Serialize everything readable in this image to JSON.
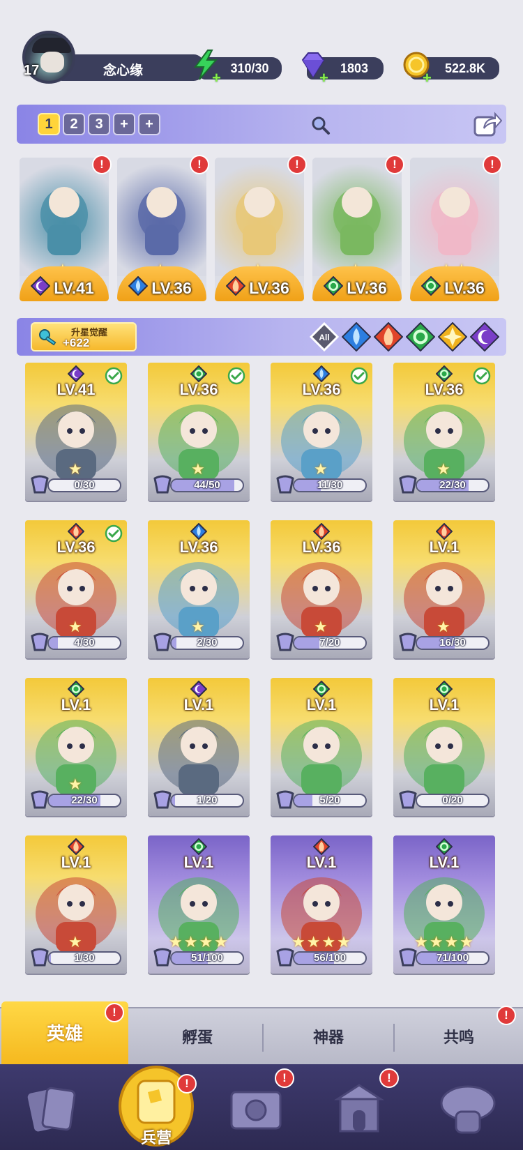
{
  "player": {
    "level": "17",
    "name": "念心缘"
  },
  "resources": {
    "energy": "310/30",
    "gems": "1803",
    "gold": "522.8K"
  },
  "team_tabs": [
    "1",
    "2",
    "3",
    "+",
    "+"
  ],
  "team": [
    {
      "element": "dark",
      "level": "LV.41",
      "stars": 1,
      "alert": "!"
    },
    {
      "element": "water",
      "level": "LV.36",
      "stars": 1,
      "alert": "!"
    },
    {
      "element": "fire",
      "level": "LV.36",
      "stars": 1,
      "alert": "!"
    },
    {
      "element": "wind",
      "level": "LV.36",
      "stars": 1,
      "alert": "!"
    },
    {
      "element": "wind",
      "level": "LV.36",
      "stars": 2,
      "alert": "!"
    }
  ],
  "awaken": {
    "label": "升星觉醒",
    "value": "+622"
  },
  "filters": [
    "All",
    "water",
    "fire",
    "wind",
    "light",
    "dark"
  ],
  "heroes": [
    {
      "element": "dark",
      "level": "LV.41",
      "progress": "0/30",
      "frac": 0.0,
      "checked": true,
      "frame": "gold",
      "stars": 1
    },
    {
      "element": "wind",
      "level": "LV.36",
      "progress": "44/50",
      "frac": 0.88,
      "checked": true,
      "frame": "gold",
      "stars": 1
    },
    {
      "element": "water",
      "level": "LV.36",
      "progress": "11/30",
      "frac": 0.37,
      "checked": true,
      "frame": "gold",
      "stars": 1
    },
    {
      "element": "wind",
      "level": "LV.36",
      "progress": "22/30",
      "frac": 0.73,
      "checked": true,
      "frame": "gold",
      "stars": 1
    },
    {
      "element": "fire",
      "level": "LV.36",
      "progress": "4/30",
      "frac": 0.13,
      "checked": true,
      "frame": "gold",
      "stars": 1
    },
    {
      "element": "water",
      "level": "LV.36",
      "progress": "2/30",
      "frac": 0.07,
      "checked": false,
      "frame": "gold",
      "stars": 1
    },
    {
      "element": "fire",
      "level": "LV.36",
      "progress": "7/20",
      "frac": 0.35,
      "checked": false,
      "frame": "gold",
      "stars": 1
    },
    {
      "element": "fire",
      "level": "LV.1",
      "progress": "16/30",
      "frac": 0.53,
      "checked": false,
      "frame": "gold",
      "stars": 1
    },
    {
      "element": "wind",
      "level": "LV.1",
      "progress": "22/30",
      "frac": 0.73,
      "checked": false,
      "frame": "gold",
      "stars": 1
    },
    {
      "element": "dark",
      "level": "LV.1",
      "progress": "1/20",
      "frac": 0.05,
      "checked": false,
      "frame": "gold",
      "stars": 0
    },
    {
      "element": "wind",
      "level": "LV.1",
      "progress": "5/20",
      "frac": 0.25,
      "checked": false,
      "frame": "gold",
      "stars": 0
    },
    {
      "element": "wind",
      "level": "LV.1",
      "progress": "0/20",
      "frac": 0.0,
      "checked": false,
      "frame": "gold",
      "stars": 0
    },
    {
      "element": "fire",
      "level": "LV.1",
      "progress": "1/30",
      "frac": 0.03,
      "checked": false,
      "frame": "gold",
      "stars": 1
    },
    {
      "element": "wind",
      "level": "LV.1",
      "progress": "51/100",
      "frac": 0.51,
      "checked": false,
      "frame": "purple",
      "stars": 4
    },
    {
      "element": "fire",
      "level": "LV.1",
      "progress": "56/100",
      "frac": 0.56,
      "checked": false,
      "frame": "purple",
      "stars": 4
    },
    {
      "element": "wind",
      "level": "LV.1",
      "progress": "71/100",
      "frac": 0.71,
      "checked": false,
      "frame": "purple",
      "stars": 4
    }
  ],
  "subtabs": [
    {
      "label": "英雄",
      "active": true,
      "alert": "!"
    },
    {
      "label": "孵蛋",
      "active": false
    },
    {
      "label": "神器",
      "active": false
    },
    {
      "label": "共鸣",
      "active": false,
      "alert": "!"
    }
  ],
  "nav": [
    {
      "name": "cards",
      "alert": ""
    },
    {
      "name": "barracks",
      "label": "兵营",
      "active": true,
      "alert": "!"
    },
    {
      "name": "map",
      "alert": "!"
    },
    {
      "name": "temple",
      "alert": "!"
    },
    {
      "name": "mushroom-house",
      "alert": ""
    }
  ],
  "colors": {
    "dark": "#7a3ec8",
    "water": "#2c7ee0",
    "fire": "#e0442a",
    "wind": "#2aa84a",
    "light": "#f0b21e",
    "accent_gold": "#f5b81e",
    "panel_purple": "#8a84e6",
    "nav_bg": "#2d2a52"
  }
}
